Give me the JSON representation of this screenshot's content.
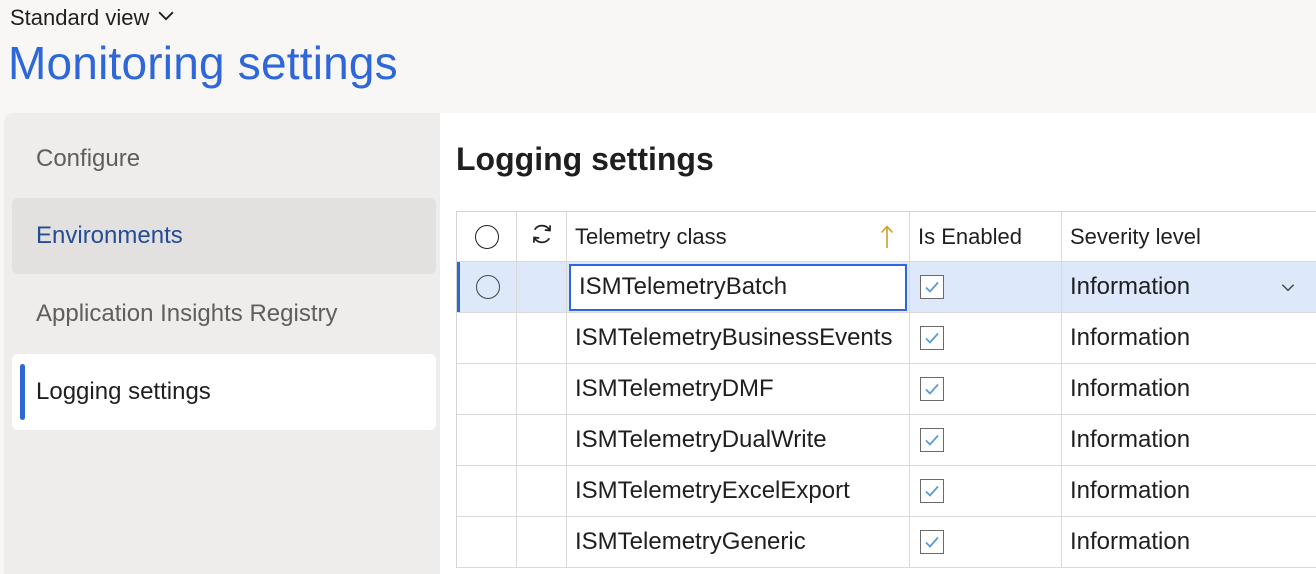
{
  "header": {
    "view_label": "Standard view",
    "page_title": "Monitoring settings"
  },
  "nav": {
    "items": [
      {
        "label": "Configure"
      },
      {
        "label": "Environments"
      },
      {
        "label": "Application Insights Registry"
      },
      {
        "label": "Logging settings"
      }
    ],
    "active_index": 3
  },
  "main": {
    "section_title": "Logging settings",
    "grid": {
      "columns": {
        "telemetry_class": "Telemetry class",
        "is_enabled": "Is Enabled",
        "severity_level": "Severity level"
      },
      "sort": {
        "column": "telemetry_class",
        "direction": "ascending"
      },
      "rows": [
        {
          "telemetry_class": "ISMTelemetryBatch",
          "is_enabled": true,
          "severity_level": "Information"
        },
        {
          "telemetry_class": "ISMTelemetryBusinessEvents",
          "is_enabled": true,
          "severity_level": "Information"
        },
        {
          "telemetry_class": "ISMTelemetryDMF",
          "is_enabled": true,
          "severity_level": "Information"
        },
        {
          "telemetry_class": "ISMTelemetryDualWrite",
          "is_enabled": true,
          "severity_level": "Information"
        },
        {
          "telemetry_class": "ISMTelemetryExcelExport",
          "is_enabled": true,
          "severity_level": "Information"
        },
        {
          "telemetry_class": "ISMTelemetryGeneric",
          "is_enabled": true,
          "severity_level": "Information"
        }
      ],
      "selected_row": 0
    }
  },
  "colors": {
    "accent": "#2d67d8",
    "selected_row_bg": "#dde8fb",
    "nav_bg": "#efedeb"
  },
  "icons": {
    "view_dropdown": "chevron-down-icon",
    "select_all": "radio-icon",
    "refresh": "refresh-icon",
    "sort": "sort-ascending-icon",
    "checkbox": "checkmark-icon",
    "severity_dropdown": "chevron-down-icon"
  }
}
